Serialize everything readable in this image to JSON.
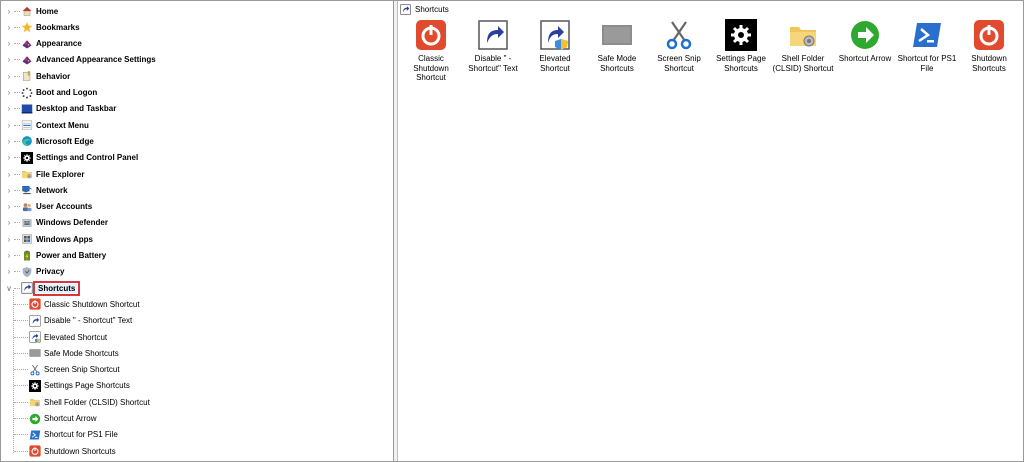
{
  "tree": {
    "categories": [
      {
        "label": "Home",
        "icon": "home-icon"
      },
      {
        "label": "Bookmarks",
        "icon": "star-icon"
      },
      {
        "label": "Appearance",
        "icon": "palette-icon"
      },
      {
        "label": "Advanced Appearance Settings",
        "icon": "palette-icon"
      },
      {
        "label": "Behavior",
        "icon": "toolbox-icon"
      },
      {
        "label": "Boot and Logon",
        "icon": "spinner-icon"
      },
      {
        "label": "Desktop and Taskbar",
        "icon": "taskbar-icon"
      },
      {
        "label": "Context Menu",
        "icon": "context-menu-icon"
      },
      {
        "label": "Microsoft Edge",
        "icon": "edge-icon"
      },
      {
        "label": "Settings and Control Panel",
        "icon": "gear-icon"
      },
      {
        "label": "File Explorer",
        "icon": "folder-icon"
      },
      {
        "label": "Network",
        "icon": "network-icon"
      },
      {
        "label": "User Accounts",
        "icon": "users-icon"
      },
      {
        "label": "Windows Defender",
        "icon": "defender-icon"
      },
      {
        "label": "Windows Apps",
        "icon": "apps-icon"
      },
      {
        "label": "Power and Battery",
        "icon": "battery-icon"
      },
      {
        "label": "Privacy",
        "icon": "privacy-icon"
      },
      {
        "label": "Shortcuts",
        "icon": "shortcut-icon"
      }
    ],
    "children": [
      {
        "label": "Classic Shutdown Shortcut",
        "icon": "power-icon"
      },
      {
        "label": "Disable \" - Shortcut\" Text",
        "icon": "shortcut-arrow-icon"
      },
      {
        "label": "Elevated Shortcut",
        "icon": "shield-shortcut-icon"
      },
      {
        "label": "Safe Mode Shortcuts",
        "icon": "safe-mode-icon"
      },
      {
        "label": "Screen Snip Shortcut",
        "icon": "scissors-icon"
      },
      {
        "label": "Settings Page Shortcuts",
        "icon": "gear-icon"
      },
      {
        "label": "Shell Folder (CLSID) Shortcut",
        "icon": "folder-icon"
      },
      {
        "label": "Shortcut Arrow",
        "icon": "green-arrow-icon"
      },
      {
        "label": "Shortcut for PS1 File",
        "icon": "powershell-icon"
      },
      {
        "label": "Shutdown Shortcuts",
        "icon": "power-icon"
      }
    ]
  },
  "content": {
    "breadcrumb": "Shortcuts",
    "tiles": [
      {
        "caption": "Classic Shutdown Shortcut",
        "icon": "power-icon"
      },
      {
        "caption": "Disable \" - Shortcut\" Text",
        "icon": "shortcut-arrow-icon"
      },
      {
        "caption": "Elevated Shortcut",
        "icon": "shield-shortcut-icon"
      },
      {
        "caption": "Safe Mode Shortcuts",
        "icon": "safe-mode-icon"
      },
      {
        "caption": "Screen Snip Shortcut",
        "icon": "scissors-icon"
      },
      {
        "caption": "Settings Page Shortcuts",
        "icon": "gear-icon"
      },
      {
        "caption": "Shell Folder (CLSID) Shortcut",
        "icon": "folder-icon"
      },
      {
        "caption": "Shortcut Arrow",
        "icon": "green-arrow-icon"
      },
      {
        "caption": "Shortcut for PS1 File",
        "icon": "powershell-icon"
      },
      {
        "caption": "Shutdown Shortcuts",
        "icon": "power-icon"
      }
    ]
  },
  "colors": {
    "selection_outline": "#d9363e",
    "power_red": "#e04a2f",
    "ps_blue": "#2b6fce",
    "green": "#2fa82f"
  }
}
